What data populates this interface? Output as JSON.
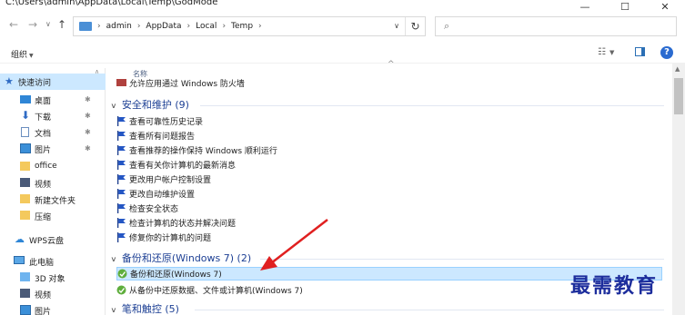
{
  "window": {
    "title": "C:\\Users\\admin\\AppData\\Local\\Temp\\GodMode"
  },
  "nav": {
    "back": "←",
    "forward": "→",
    "recent": "∨",
    "up": "↑"
  },
  "address": {
    "crumbs": [
      "admin",
      "AppData",
      "Local",
      "Temp"
    ],
    "separator": "›",
    "dropdown": "∨",
    "refresh": "↻"
  },
  "search": {
    "icon": "search-icon"
  },
  "toolbar": {
    "organize": "组织",
    "organize_caret": "▼",
    "help": "?"
  },
  "sidebar": {
    "items": [
      {
        "label": "快速访问",
        "icon": "star-icon"
      },
      {
        "label": "桌面",
        "icon": "desktop-icon"
      },
      {
        "label": "下载",
        "icon": "download-icon"
      },
      {
        "label": "文档",
        "icon": "document-icon"
      },
      {
        "label": "图片",
        "icon": "pictures-icon"
      },
      {
        "label": "office",
        "icon": "folder-icon"
      },
      {
        "label": "视频",
        "icon": "video-icon"
      },
      {
        "label": "新建文件夹",
        "icon": "folder-icon"
      },
      {
        "label": "压缩",
        "icon": "folder-icon"
      },
      {
        "label": "WPS云盘",
        "icon": "cloud-icon"
      },
      {
        "label": "此电脑",
        "icon": "computer-icon"
      },
      {
        "label": "3D 对象",
        "icon": "3d-objects-icon"
      },
      {
        "label": "视频",
        "icon": "video-icon"
      },
      {
        "label": "图片",
        "icon": "pictures-icon"
      }
    ]
  },
  "content": {
    "column_header": "名称",
    "partial_top_item": "允许应用通过 Windows 防火墙",
    "groups": [
      {
        "title": "安全和维护 (9)",
        "items": [
          "查看可靠性历史记录",
          "查看所有问题报告",
          "查看推荐的操作保持 Windows 顺利运行",
          "查看有关你计算机的最新消息",
          "更改用户帐户控制设置",
          "更改自动维护设置",
          "检查安全状态",
          "检查计算机的状态并解决问题",
          "修复你的计算机的问题"
        ]
      },
      {
        "title": "备份和还原(Windows 7) (2)",
        "items": [
          "备份和还原(Windows 7)",
          "从备份中还原数据、文件或计算机(Windows 7)"
        ]
      },
      {
        "title": "笔和触控 (5)",
        "items": []
      }
    ]
  },
  "watermark": "最需教育",
  "colors": {
    "accent": "#1c3f94",
    "selection": "#cce8ff",
    "arrow": "#e02020"
  }
}
